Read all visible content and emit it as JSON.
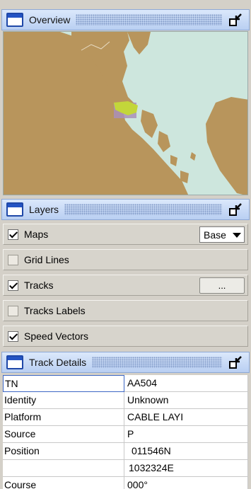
{
  "overview": {
    "title": "Overview"
  },
  "layers": {
    "title": "Layers",
    "items": [
      {
        "label": "Maps",
        "checked": true,
        "control": "Base"
      },
      {
        "label": "Grid Lines",
        "checked": false
      },
      {
        "label": "Tracks",
        "checked": true,
        "control": "..."
      },
      {
        "label": "Tracks Labels",
        "checked": false
      },
      {
        "label": "Speed Vectors",
        "checked": true
      }
    ]
  },
  "track_details": {
    "title": "Track Details",
    "rows": [
      {
        "key": "TN",
        "value": "AA504"
      },
      {
        "key": "Identity",
        "value": "Unknown"
      },
      {
        "key": "Platform",
        "value": "CABLE LAYI"
      },
      {
        "key": "Source",
        "value": "P"
      },
      {
        "key": "Position",
        "value": "011546N"
      },
      {
        "key": "",
        "value": "1032324E"
      },
      {
        "key": "Course",
        "value": "000°"
      }
    ]
  },
  "colors": {
    "land": "#b8955c",
    "sea": "#cde6dd",
    "track_area": "#c3d63a",
    "viewport": "#a98fb8",
    "header": "#c9dbf6"
  },
  "icons": {
    "panel": "window-icon",
    "restore": "restore-down-icon"
  }
}
